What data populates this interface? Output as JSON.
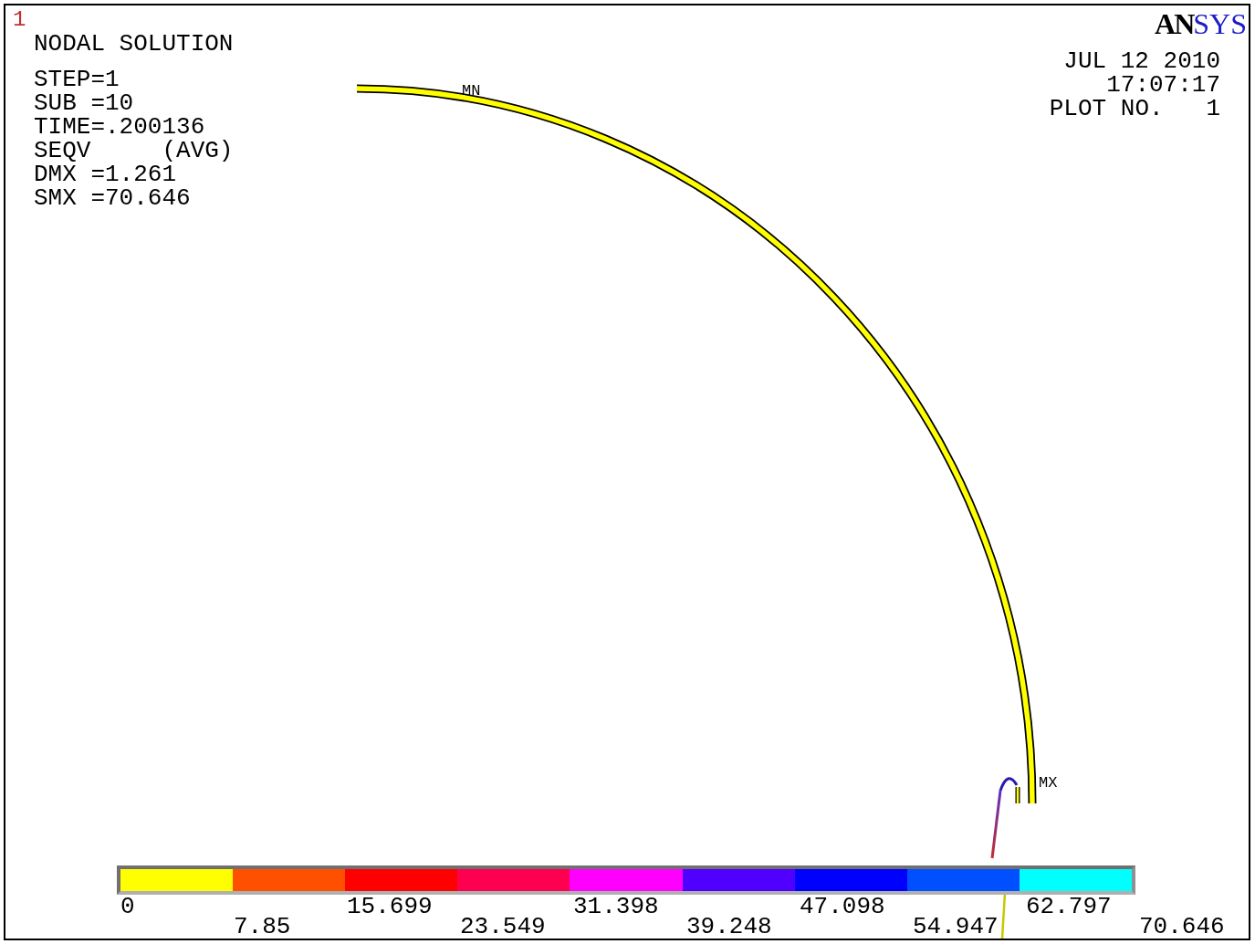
{
  "window": {
    "number": "1"
  },
  "plot_title": "NODAL SOLUTION",
  "info_lines": [
    "STEP=1",
    "SUB =10",
    "TIME=.200136",
    "SEQV     (AVG)",
    "DMX =1.261",
    "SMX =70.646"
  ],
  "logo": [
    "AN",
    "SYS"
  ],
  "stamp_lines": [
    "JUL 12 2010",
    "17:07:17",
    "PLOT NO.   1"
  ],
  "markers": [
    {
      "label": "MN"
    },
    {
      "label": "MX"
    }
  ],
  "legend": {
    "bins": [
      {
        "color": "#ffff00"
      },
      {
        "color": "#ff5000"
      },
      {
        "color": "#ff0000"
      },
      {
        "color": "#ff0050"
      },
      {
        "color": "#ff00ff"
      },
      {
        "color": "#5000ff"
      },
      {
        "color": "#0000ff"
      },
      {
        "color": "#0050ff"
      },
      {
        "color": "#00ffff"
      }
    ],
    "ticks": [
      "0",
      "7.85",
      "15.699",
      "23.549",
      "31.398",
      "39.248",
      "47.098",
      "54.947",
      "62.797",
      "70.646"
    ]
  }
}
